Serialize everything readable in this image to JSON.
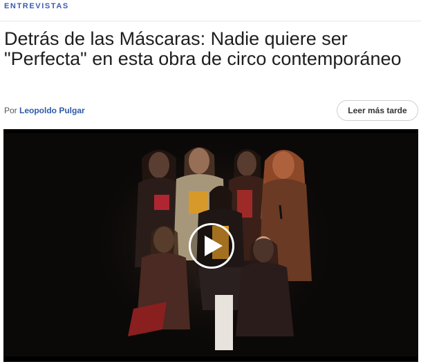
{
  "article": {
    "category": "ENTREVISTAS",
    "headline": "Detrás de las Máscaras: Nadie quiere ser \"Perfecta\" en esta obra de circo contemporáneo",
    "byline_prefix": "Por ",
    "author": "Leopoldo Pulgar",
    "read_later_label": "Leer más tarde"
  },
  "video": {
    "alt": "",
    "play_icon": "play-icon"
  },
  "colors": {
    "category": "#3a5bb0",
    "author_link": "#2c5aa8",
    "headline": "#1e1e1e",
    "video_background": "#0b0908"
  }
}
